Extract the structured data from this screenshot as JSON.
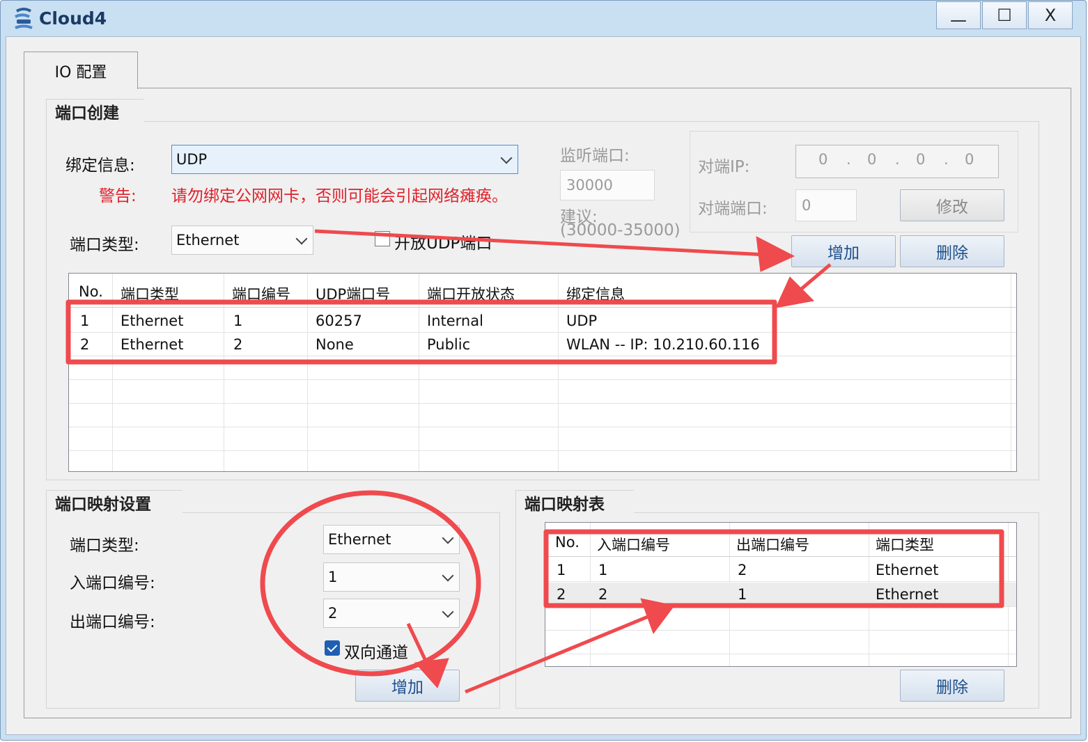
{
  "window": {
    "title": "Cloud4",
    "controls": {
      "minimize": "—",
      "maximize": "☐",
      "close": "X"
    }
  },
  "tabs": [
    {
      "label": "IO 配置"
    }
  ],
  "port_create": {
    "group_title": "端口创建",
    "bind_label": "绑定信息:",
    "bind_value": "UDP",
    "warning_label": "警告:",
    "warning_text": "请勿绑定公网网卡，否则可能会引起网络瘫痪。",
    "port_type_label": "端口类型:",
    "port_type_value": "Ethernet",
    "udp_open_label": "开放UDP端口",
    "udp_open_checked": false,
    "listen_port_label": "监听端口:",
    "listen_port_value": "30000",
    "suggest_label": "建议:",
    "suggest_range": "(30000-35000)",
    "peer_ip_label": "对端IP:",
    "peer_ip_octets": [
      "0",
      "0",
      "0",
      "0"
    ],
    "peer_port_label": "对端端口:",
    "peer_port_value": "0",
    "modify_button": "修改",
    "add_button": "增加",
    "delete_button": "删除",
    "table": {
      "columns": [
        "No.",
        "端口类型",
        "端口编号",
        "UDP端口号",
        "端口开放状态",
        "绑定信息"
      ],
      "rows": [
        [
          "1",
          "Ethernet",
          "1",
          "60257",
          "Internal",
          "UDP"
        ],
        [
          "2",
          "Ethernet",
          "2",
          "None",
          "Public",
          "WLAN -- IP: 10.210.60.116"
        ]
      ]
    }
  },
  "mapping_settings": {
    "group_title": "端口映射设置",
    "port_type_label": "端口类型:",
    "port_type_value": "Ethernet",
    "in_port_label": "入端口编号:",
    "in_port_value": "1",
    "out_port_label": "出端口编号:",
    "out_port_value": "2",
    "bidirectional_label": "双向通道",
    "bidirectional_checked": true,
    "add_button": "增加"
  },
  "mapping_table": {
    "group_title": "端口映射表",
    "columns": [
      "No.",
      "入端口编号",
      "出端口编号",
      "端口类型"
    ],
    "rows": [
      [
        "1",
        "1",
        "2",
        "Ethernet"
      ],
      [
        "2",
        "2",
        "1",
        "Ethernet"
      ]
    ],
    "delete_button": "删除"
  },
  "annotation_color": "#ef4a4d"
}
